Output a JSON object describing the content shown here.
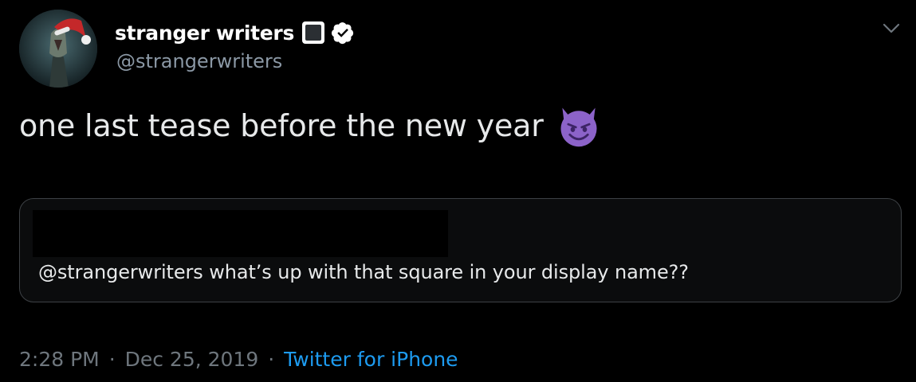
{
  "author": {
    "display_name": "stranger writers",
    "handle": "@strangerwriters",
    "square_glyph_icon": "square-icon",
    "verified_icon": "verified-badge-icon",
    "avatar_icon": "avatar-image"
  },
  "header": {
    "menu_icon": "chevron-down-icon"
  },
  "tweet": {
    "text": "one last tease before the new year",
    "emoji": "smiling-face-with-horns-emoji"
  },
  "quote": {
    "text": "@strangerwriters what’s up with that square in your display name??",
    "redacted": true
  },
  "meta": {
    "time": "2:28 PM",
    "separator": "·",
    "date": "Dec 25, 2019",
    "source": "Twitter for iPhone"
  },
  "colors": {
    "background": "#000000",
    "text": "#e7e9ea",
    "muted": "#6e767d",
    "link": "#1d9bf0",
    "card_border": "#3d4145",
    "emoji_purple": "#8c63c9"
  }
}
